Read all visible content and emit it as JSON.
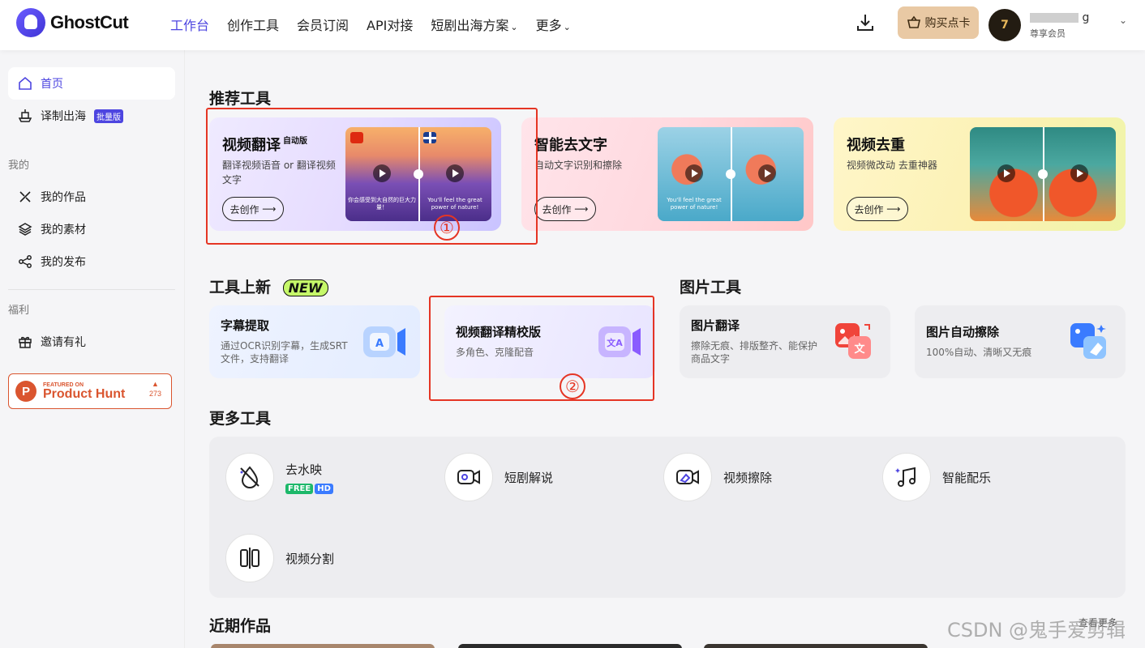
{
  "header": {
    "brand": "GhostCut",
    "nav": [
      {
        "label": "工作台",
        "active": true
      },
      {
        "label": "创作工具"
      },
      {
        "label": "会员订阅"
      },
      {
        "label": "API对接"
      },
      {
        "label": "短剧出海方案",
        "dropdown": true
      },
      {
        "label": "更多",
        "dropdown": true
      }
    ],
    "buy_label": "购买点卡",
    "avatar_text": "7",
    "user_name_visible": "g",
    "user_level": "尊享会员"
  },
  "sidebar": {
    "items": [
      {
        "label": "首页",
        "icon": "home-icon",
        "active": true
      },
      {
        "label": "译制出海",
        "icon": "translate-ship-icon",
        "badge": "批量版"
      }
    ],
    "group_mine": "我的",
    "mine_items": [
      {
        "label": "我的作品",
        "icon": "works-icon"
      },
      {
        "label": "我的素材",
        "icon": "layers-icon"
      },
      {
        "label": "我的发布",
        "icon": "share-icon"
      }
    ],
    "group_benefit": "福利",
    "benefit_items": [
      {
        "label": "邀请有礼",
        "icon": "gift-icon"
      }
    ],
    "product_hunt": {
      "featured": "FEATURED ON",
      "name": "Product Hunt",
      "count": "273"
    }
  },
  "recommended": {
    "title": "推荐工具",
    "cards": [
      {
        "title": "视频翻译",
        "tag": "自动版",
        "desc": "翻译视频语音 or 翻译视频文字",
        "button": "去创作",
        "caption_left": "你会感受到大自然的巨大力量！",
        "caption_right": "You'll feel the great power of nature!"
      },
      {
        "title": "智能去文字",
        "desc": "自动文字识别和擦除",
        "button": "去创作",
        "caption_left": "You'll feel the great power of nature!"
      },
      {
        "title": "视频去重",
        "desc": "视频微改动 去重神器",
        "button": "去创作"
      }
    ]
  },
  "new_tools": {
    "title": "工具上新",
    "new_badge": "NEW",
    "cards": [
      {
        "title": "字幕提取",
        "desc": "通过OCR识别字幕，生成SRT文件，支持翻译"
      },
      {
        "title": "视频翻译精校版",
        "desc": "多角色、克隆配音"
      }
    ]
  },
  "image_tools": {
    "title": "图片工具",
    "cards": [
      {
        "title": "图片翻译",
        "desc": "擦除无痕、排版整齐、能保护商品文字"
      },
      {
        "title": "图片自动擦除",
        "desc": "100%自动、清晰又无痕"
      }
    ]
  },
  "more_tools": {
    "title": "更多工具",
    "items": [
      {
        "label": "去水映",
        "badges": [
          "FREE",
          "HD"
        ],
        "icon": "watermark-remove-icon"
      },
      {
        "label": "短剧解说",
        "icon": "narration-camera-icon"
      },
      {
        "label": "视频擦除",
        "icon": "video-erase-icon"
      },
      {
        "label": "智能配乐",
        "icon": "music-icon"
      },
      {
        "label": "视频分割",
        "icon": "split-icon"
      }
    ]
  },
  "recent": {
    "title": "近期作品",
    "view_more": "查看更多"
  },
  "annotations": {
    "num1": "①",
    "num2": "②"
  },
  "watermark": "CSDN @鬼手爱剪辑",
  "colors": {
    "accent": "#4d45e0",
    "highlight_box": "#e53524",
    "product_hunt": "#da552f"
  }
}
